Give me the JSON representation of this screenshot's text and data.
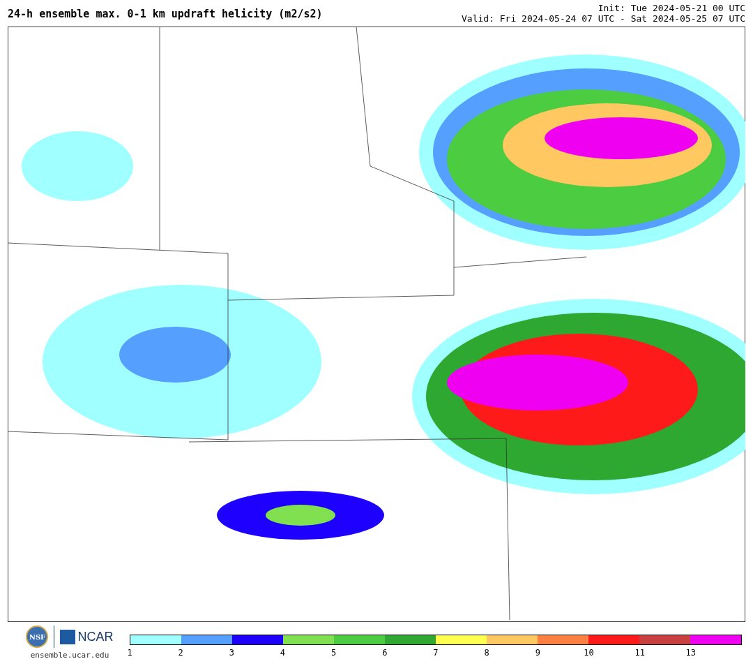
{
  "header": {
    "title": "24-h ensemble max. 0-1 km updraft helicity (m2/s2)",
    "init": "Init: Tue 2024-05-21 00 UTC",
    "valid": "Valid: Fri 2024-05-24 07 UTC - Sat 2024-05-25 07 UTC"
  },
  "footer": {
    "nsf_logo": "NSF",
    "ncar_logo": "NCAR",
    "site": "ensemble.ucar.edu"
  },
  "legend": {
    "bins": [
      {
        "color": "#a0ffff"
      },
      {
        "color": "#55a0ff"
      },
      {
        "color": "#1e00ff"
      },
      {
        "color": "#80e050"
      },
      {
        "color": "#4ccc40"
      },
      {
        "color": "#2ea830"
      },
      {
        "color": "#ffff50"
      },
      {
        "color": "#ffc860"
      },
      {
        "color": "#ff8040"
      },
      {
        "color": "#ff1a1a"
      },
      {
        "color": "#c84040"
      },
      {
        "color": "#f000f0"
      }
    ],
    "labels": [
      "1",
      "2",
      "3",
      "4",
      "5",
      "6",
      "7",
      "8",
      "9",
      "10",
      "11",
      "13"
    ]
  }
}
